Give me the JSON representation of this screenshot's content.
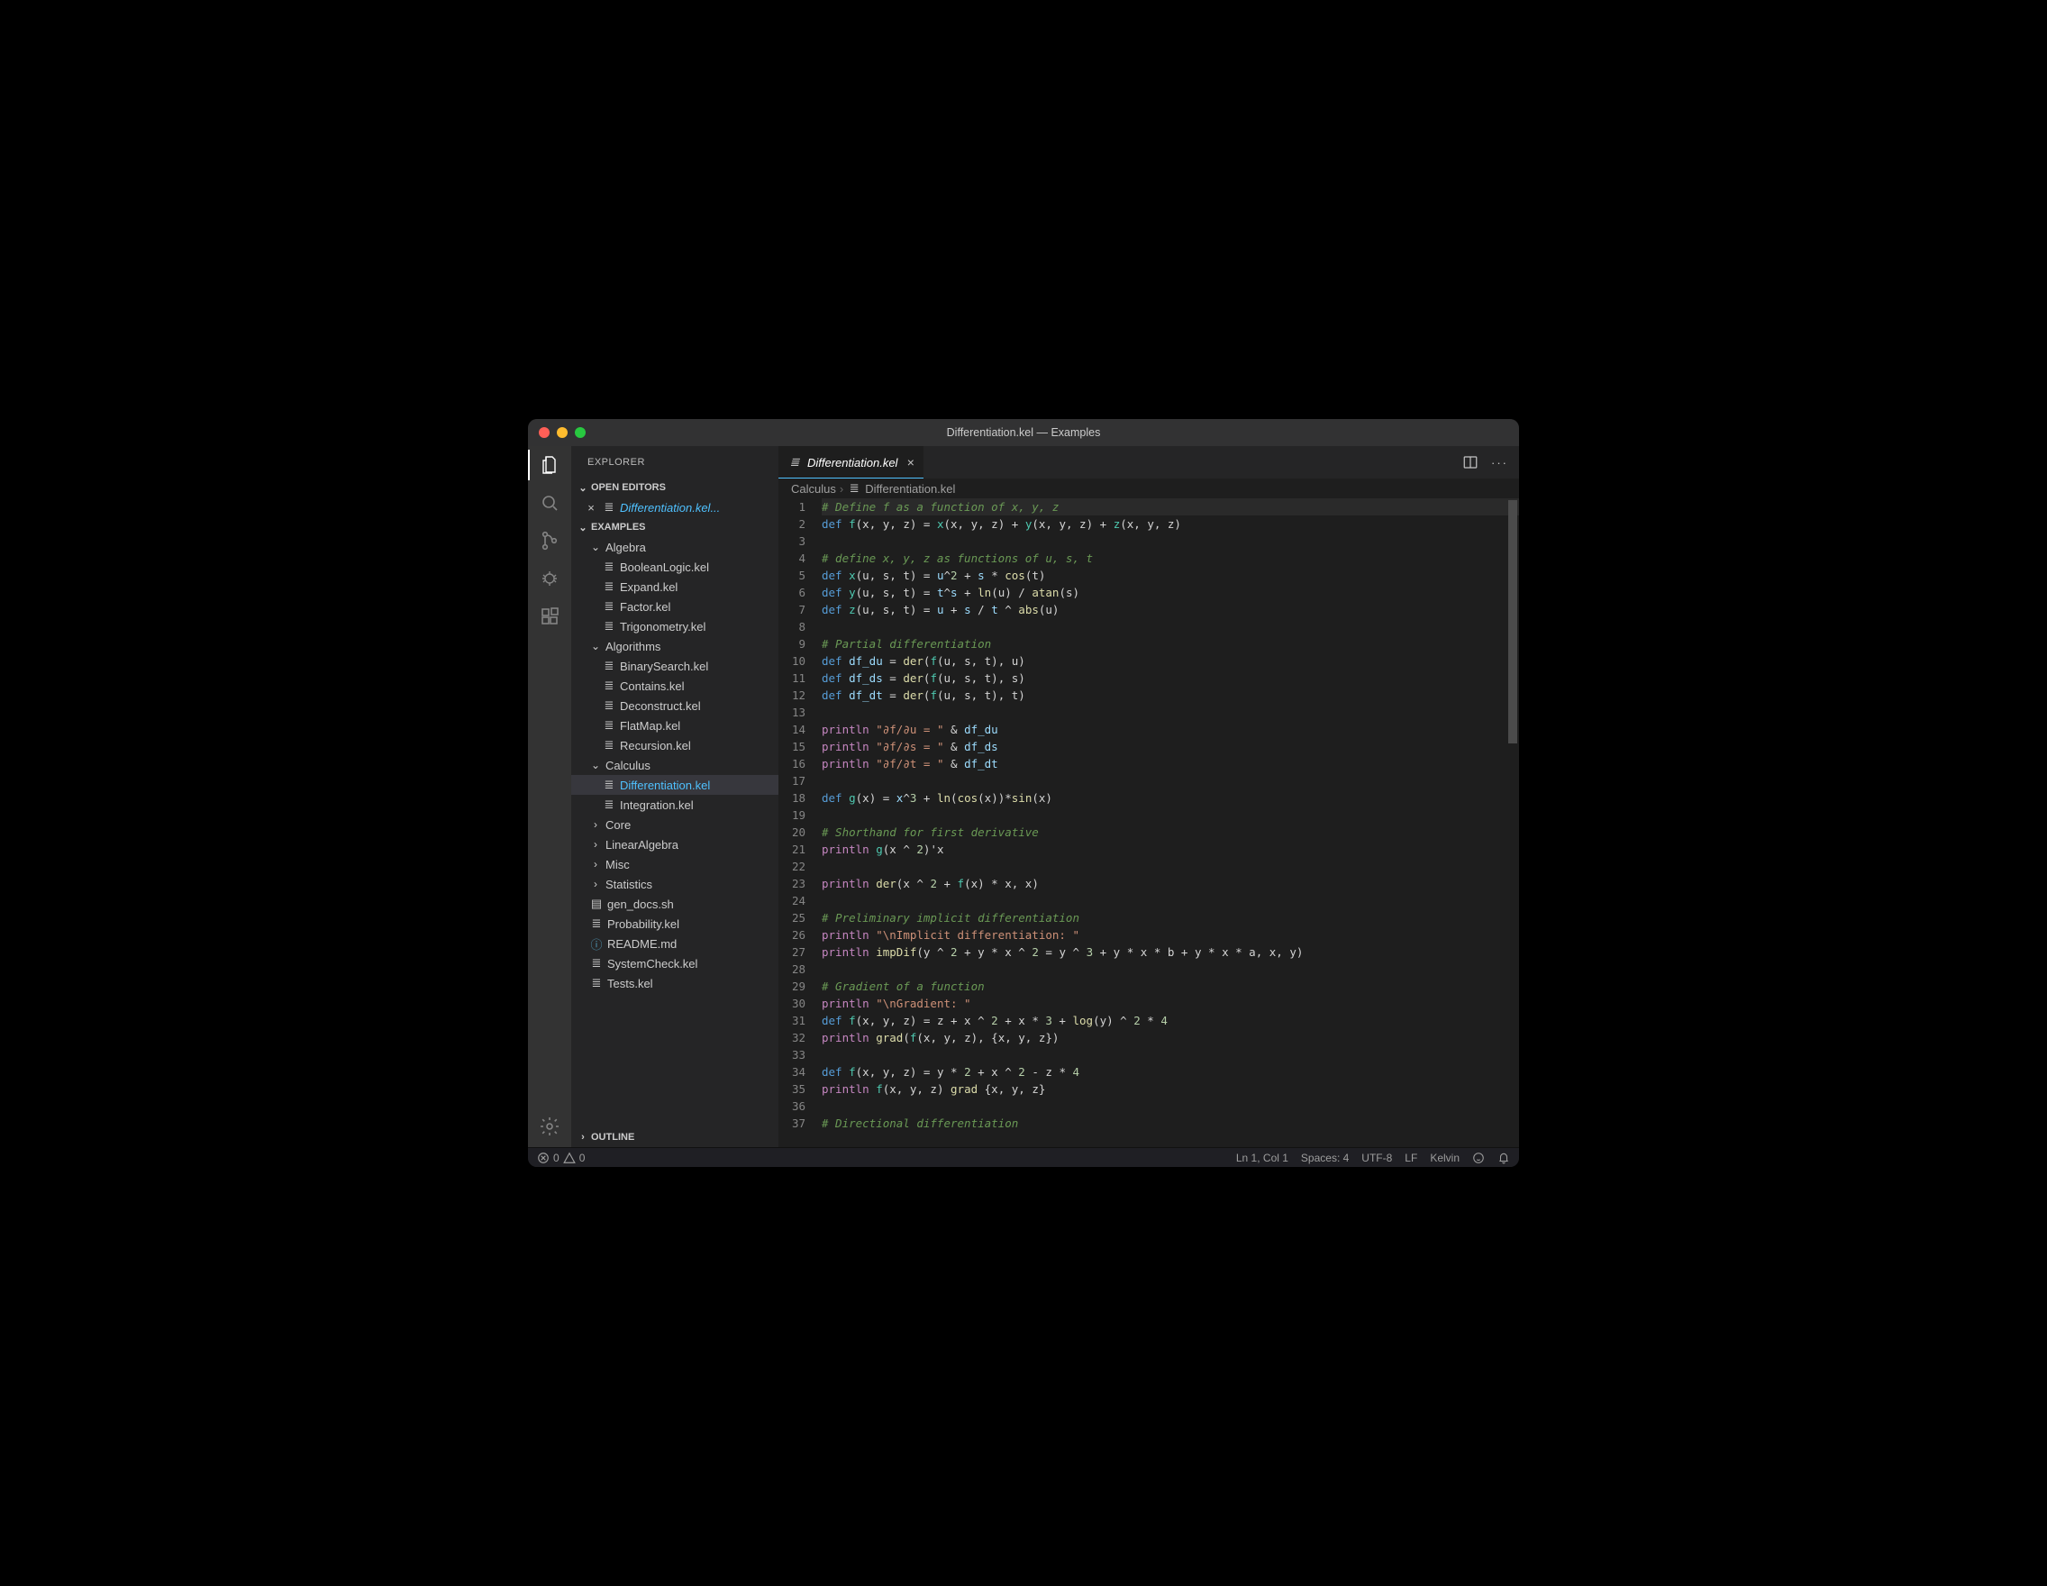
{
  "window": {
    "title": "Differentiation.kel — Examples"
  },
  "activity": {
    "items": [
      "files",
      "search",
      "scm",
      "debug",
      "extensions"
    ],
    "bottom": "settings"
  },
  "sidebar": {
    "title": "EXPLORER",
    "open_editors_label": "OPEN EDITORS",
    "open_editors": [
      {
        "label": "Differentiation.kel...",
        "icon": "≣"
      }
    ],
    "root_label": "EXAMPLES",
    "outline_label": "OUTLINE",
    "tree": [
      {
        "label": "Algebra",
        "type": "folder",
        "open": true,
        "depth": 1,
        "children": [
          {
            "label": "BooleanLogic.kel",
            "icon": "≣",
            "depth": 2
          },
          {
            "label": "Expand.kel",
            "icon": "≣",
            "depth": 2
          },
          {
            "label": "Factor.kel",
            "icon": "≣",
            "depth": 2
          },
          {
            "label": "Trigonometry.kel",
            "icon": "≣",
            "depth": 2
          }
        ]
      },
      {
        "label": "Algorithms",
        "type": "folder",
        "open": true,
        "depth": 1,
        "children": [
          {
            "label": "BinarySearch.kel",
            "icon": "≣",
            "depth": 2
          },
          {
            "label": "Contains.kel",
            "icon": "≣",
            "depth": 2
          },
          {
            "label": "Deconstruct.kel",
            "icon": "≣",
            "depth": 2
          },
          {
            "label": "FlatMap.kel",
            "icon": "≣",
            "depth": 2
          },
          {
            "label": "Recursion.kel",
            "icon": "≣",
            "depth": 2
          }
        ]
      },
      {
        "label": "Calculus",
        "type": "folder",
        "open": true,
        "depth": 1,
        "children": [
          {
            "label": "Differentiation.kel",
            "icon": "≣",
            "depth": 2,
            "active": true
          },
          {
            "label": "Integration.kel",
            "icon": "≣",
            "depth": 2
          }
        ]
      },
      {
        "label": "Core",
        "type": "folder",
        "open": false,
        "depth": 1
      },
      {
        "label": "LinearAlgebra",
        "type": "folder",
        "open": false,
        "depth": 1
      },
      {
        "label": "Misc",
        "type": "folder",
        "open": false,
        "depth": 1
      },
      {
        "label": "Statistics",
        "type": "folder",
        "open": false,
        "depth": 1
      },
      {
        "label": "gen_docs.sh",
        "icon": "▤",
        "depth": 1
      },
      {
        "label": "Probability.kel",
        "icon": "≣",
        "depth": 1
      },
      {
        "label": "README.md",
        "icon": "ⓘ",
        "depth": 1,
        "iconColor": "#519aba"
      },
      {
        "label": "SystemCheck.kel",
        "icon": "≣",
        "depth": 1
      },
      {
        "label": "Tests.kel",
        "icon": "≣",
        "depth": 1
      }
    ]
  },
  "tab": {
    "label": "Differentiation.kel",
    "icon": "≣"
  },
  "breadcrumbs": {
    "folder": "Calculus",
    "file": "Differentiation.kel"
  },
  "status": {
    "errors": "0",
    "warnings": "0",
    "ln_col": "Ln 1, Col 1",
    "spaces": "Spaces: 4",
    "encoding": "UTF-8",
    "eol": "LF",
    "lang": "Kelvin"
  },
  "code": [
    {
      "n": 1,
      "hl": true,
      "t": [
        [
          "cm",
          "# Define f as a function of x, y, z"
        ]
      ]
    },
    {
      "n": 2,
      "t": [
        [
          "kw",
          "def "
        ],
        [
          "fn",
          "f"
        ],
        [
          "op",
          "(x, y, z) "
        ],
        [
          "op",
          "= "
        ],
        [
          "fn",
          "x"
        ],
        [
          "op",
          "(x, y, z) "
        ],
        [
          "op",
          "+ "
        ],
        [
          "fn",
          "y"
        ],
        [
          "op",
          "(x, y, z) "
        ],
        [
          "op",
          "+ "
        ],
        [
          "fn",
          "z"
        ],
        [
          "op",
          "(x, y, z)"
        ]
      ]
    },
    {
      "n": 3,
      "t": []
    },
    {
      "n": 4,
      "t": [
        [
          "cm",
          "# define x, y, z as functions of u, s, t"
        ]
      ]
    },
    {
      "n": 5,
      "t": [
        [
          "kw",
          "def "
        ],
        [
          "fn",
          "x"
        ],
        [
          "op",
          "(u, s, t) "
        ],
        [
          "op",
          "= "
        ],
        [
          "id",
          "u"
        ],
        [
          "op",
          "^"
        ],
        [
          "num",
          "2"
        ],
        [
          "op",
          " + "
        ],
        [
          "id",
          "s"
        ],
        [
          "op",
          " * "
        ],
        [
          "fn2",
          "cos"
        ],
        [
          "op",
          "(t)"
        ]
      ]
    },
    {
      "n": 6,
      "t": [
        [
          "kw",
          "def "
        ],
        [
          "fn",
          "y"
        ],
        [
          "op",
          "(u, s, t) "
        ],
        [
          "op",
          "= "
        ],
        [
          "id",
          "t"
        ],
        [
          "op",
          "^"
        ],
        [
          "id",
          "s"
        ],
        [
          "op",
          " + "
        ],
        [
          "fn2",
          "ln"
        ],
        [
          "op",
          "(u) / "
        ],
        [
          "fn2",
          "atan"
        ],
        [
          "op",
          "(s)"
        ]
      ]
    },
    {
      "n": 7,
      "t": [
        [
          "kw",
          "def "
        ],
        [
          "fn",
          "z"
        ],
        [
          "op",
          "(u, s, t) "
        ],
        [
          "op",
          "= "
        ],
        [
          "id",
          "u"
        ],
        [
          "op",
          " + "
        ],
        [
          "id",
          "s"
        ],
        [
          "op",
          " / "
        ],
        [
          "id",
          "t"
        ],
        [
          "op",
          " ^ "
        ],
        [
          "fn2",
          "abs"
        ],
        [
          "op",
          "(u)"
        ]
      ]
    },
    {
      "n": 8,
      "t": []
    },
    {
      "n": 9,
      "t": [
        [
          "cm",
          "# Partial differentiation"
        ]
      ]
    },
    {
      "n": 10,
      "t": [
        [
          "kw",
          "def "
        ],
        [
          "id",
          "df_du"
        ],
        [
          "op",
          " = "
        ],
        [
          "fn2",
          "der"
        ],
        [
          "op",
          "("
        ],
        [
          "fn",
          "f"
        ],
        [
          "op",
          "(u, s, t), u)"
        ]
      ]
    },
    {
      "n": 11,
      "t": [
        [
          "kw",
          "def "
        ],
        [
          "id",
          "df_ds"
        ],
        [
          "op",
          " = "
        ],
        [
          "fn2",
          "der"
        ],
        [
          "op",
          "("
        ],
        [
          "fn",
          "f"
        ],
        [
          "op",
          "(u, s, t), s)"
        ]
      ]
    },
    {
      "n": 12,
      "t": [
        [
          "kw",
          "def "
        ],
        [
          "id",
          "df_dt"
        ],
        [
          "op",
          " = "
        ],
        [
          "fn2",
          "der"
        ],
        [
          "op",
          "("
        ],
        [
          "fn",
          "f"
        ],
        [
          "op",
          "(u, s, t), t)"
        ]
      ]
    },
    {
      "n": 13,
      "t": []
    },
    {
      "n": 14,
      "t": [
        [
          "kw2",
          "println "
        ],
        [
          "str",
          "\"∂f/∂u = \""
        ],
        [
          "op",
          " & "
        ],
        [
          "id",
          "df_du"
        ]
      ]
    },
    {
      "n": 15,
      "t": [
        [
          "kw2",
          "println "
        ],
        [
          "str",
          "\"∂f/∂s = \""
        ],
        [
          "op",
          " & "
        ],
        [
          "id",
          "df_ds"
        ]
      ]
    },
    {
      "n": 16,
      "t": [
        [
          "kw2",
          "println "
        ],
        [
          "str",
          "\"∂f/∂t = \""
        ],
        [
          "op",
          " & "
        ],
        [
          "id",
          "df_dt"
        ]
      ]
    },
    {
      "n": 17,
      "t": []
    },
    {
      "n": 18,
      "t": [
        [
          "kw",
          "def "
        ],
        [
          "fn",
          "g"
        ],
        [
          "op",
          "(x) = "
        ],
        [
          "id",
          "x"
        ],
        [
          "op",
          "^"
        ],
        [
          "num",
          "3"
        ],
        [
          "op",
          " + "
        ],
        [
          "fn2",
          "ln"
        ],
        [
          "op",
          "("
        ],
        [
          "fn2",
          "cos"
        ],
        [
          "op",
          "(x))*"
        ],
        [
          "fn2",
          "sin"
        ],
        [
          "op",
          "(x)"
        ]
      ]
    },
    {
      "n": 19,
      "t": []
    },
    {
      "n": 20,
      "t": [
        [
          "cm",
          "# Shorthand for first derivative"
        ]
      ]
    },
    {
      "n": 21,
      "t": [
        [
          "kw2",
          "println "
        ],
        [
          "fn",
          "g"
        ],
        [
          "op",
          "(x ^ "
        ],
        [
          "num",
          "2"
        ],
        [
          "op",
          ")'x"
        ]
      ]
    },
    {
      "n": 22,
      "t": []
    },
    {
      "n": 23,
      "t": [
        [
          "kw2",
          "println "
        ],
        [
          "fn2",
          "der"
        ],
        [
          "op",
          "(x ^ "
        ],
        [
          "num",
          "2"
        ],
        [
          "op",
          " + "
        ],
        [
          "fn",
          "f"
        ],
        [
          "op",
          "(x) * x, x)"
        ]
      ]
    },
    {
      "n": 24,
      "t": []
    },
    {
      "n": 25,
      "t": [
        [
          "cm",
          "# Preliminary implicit differentiation"
        ]
      ]
    },
    {
      "n": 26,
      "t": [
        [
          "kw2",
          "println "
        ],
        [
          "str",
          "\"\\nImplicit differentiation: \""
        ]
      ]
    },
    {
      "n": 27,
      "t": [
        [
          "kw2",
          "println "
        ],
        [
          "fn2",
          "impDif"
        ],
        [
          "op",
          "(y ^ "
        ],
        [
          "num",
          "2"
        ],
        [
          "op",
          " + y * x ^ "
        ],
        [
          "num",
          "2"
        ],
        [
          "op",
          " = y ^ "
        ],
        [
          "num",
          "3"
        ],
        [
          "op",
          " + y * x * b + y * x * a, x, y)"
        ]
      ]
    },
    {
      "n": 28,
      "t": []
    },
    {
      "n": 29,
      "t": [
        [
          "cm",
          "# Gradient of a function"
        ]
      ]
    },
    {
      "n": 30,
      "t": [
        [
          "kw2",
          "println "
        ],
        [
          "str",
          "\"\\nGradient: \""
        ]
      ]
    },
    {
      "n": 31,
      "t": [
        [
          "kw",
          "def "
        ],
        [
          "fn",
          "f"
        ],
        [
          "op",
          "(x, y, z) = z + x ^ "
        ],
        [
          "num",
          "2"
        ],
        [
          "op",
          " + x * "
        ],
        [
          "num",
          "3"
        ],
        [
          "op",
          " + "
        ],
        [
          "fn2",
          "log"
        ],
        [
          "op",
          "(y) ^ "
        ],
        [
          "num",
          "2"
        ],
        [
          "op",
          " * "
        ],
        [
          "num",
          "4"
        ]
      ]
    },
    {
      "n": 32,
      "t": [
        [
          "kw2",
          "println "
        ],
        [
          "fn2",
          "grad"
        ],
        [
          "op",
          "("
        ],
        [
          "fn",
          "f"
        ],
        [
          "op",
          "(x, y, z), {x, y, z})"
        ]
      ]
    },
    {
      "n": 33,
      "t": []
    },
    {
      "n": 34,
      "t": [
        [
          "kw",
          "def "
        ],
        [
          "fn",
          "f"
        ],
        [
          "op",
          "(x, y, z) = y * "
        ],
        [
          "num",
          "2"
        ],
        [
          "op",
          " + x ^ "
        ],
        [
          "num",
          "2"
        ],
        [
          "op",
          " - z * "
        ],
        [
          "num",
          "4"
        ]
      ]
    },
    {
      "n": 35,
      "t": [
        [
          "kw2",
          "println "
        ],
        [
          "fn",
          "f"
        ],
        [
          "op",
          "(x, y, z) "
        ],
        [
          "fn2",
          "grad"
        ],
        [
          "op",
          " {x, y, z}"
        ]
      ]
    },
    {
      "n": 36,
      "t": []
    },
    {
      "n": 37,
      "t": [
        [
          "cm",
          "# Directional differentiation"
        ]
      ]
    }
  ]
}
